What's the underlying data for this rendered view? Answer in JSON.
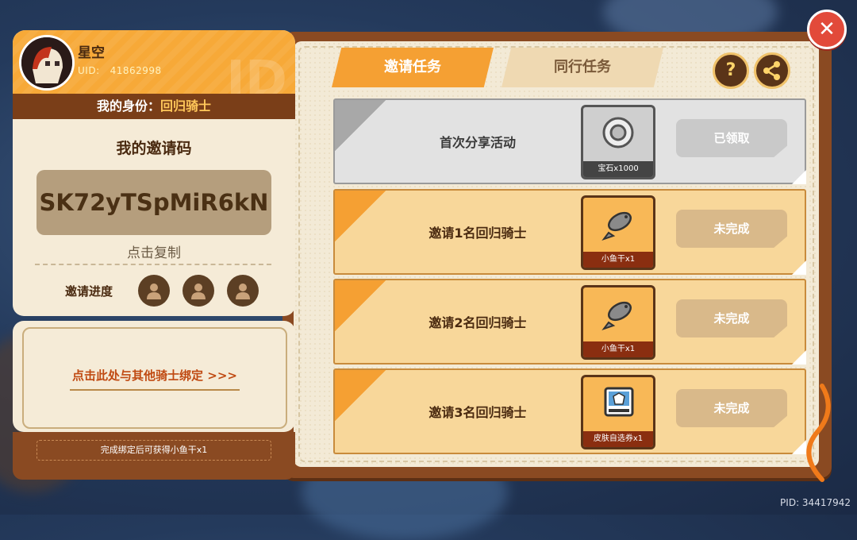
{
  "player": {
    "name": "星空",
    "uid_label": "UID:",
    "uid": "41862998"
  },
  "identity": {
    "prefix": "我的身份：",
    "value": "回归骑士"
  },
  "invite": {
    "title": "我的邀请码",
    "code": "SK72yTSpMiR6kN",
    "copy_label": "点击复制",
    "progress_label": "邀请进度"
  },
  "bind": {
    "label": "点击此处与其他骑士绑定 >>>",
    "tip": "完成绑定后可获得小鱼干x1"
  },
  "tabs": [
    {
      "label": "邀请任务",
      "active": true
    },
    {
      "label": "同行任务",
      "active": false
    }
  ],
  "icons": {
    "help": "?",
    "share": "share-icon",
    "close": "close-icon"
  },
  "tasks": [
    {
      "name": "首次分享活动",
      "reward": "宝石x1000",
      "reward_icon": "gem-icon",
      "status": "已领取",
      "state": "done"
    },
    {
      "name": "邀请1名回归骑士",
      "reward": "小鱼干x1",
      "reward_icon": "fish-icon",
      "status": "未完成",
      "state": "todo"
    },
    {
      "name": "邀请2名回归骑士",
      "reward": "小鱼干x1",
      "reward_icon": "fish-icon",
      "status": "未完成",
      "state": "todo"
    },
    {
      "name": "邀请3名回归骑士",
      "reward": "皮肤自选券x1",
      "reward_icon": "skin-ticket-icon",
      "status": "未完成",
      "state": "todo"
    }
  ],
  "footer": {
    "pid": "PID: 34417942"
  },
  "colors": {
    "accent": "#f5a033",
    "board": "#8a4a22",
    "close": "#e24a3a"
  }
}
